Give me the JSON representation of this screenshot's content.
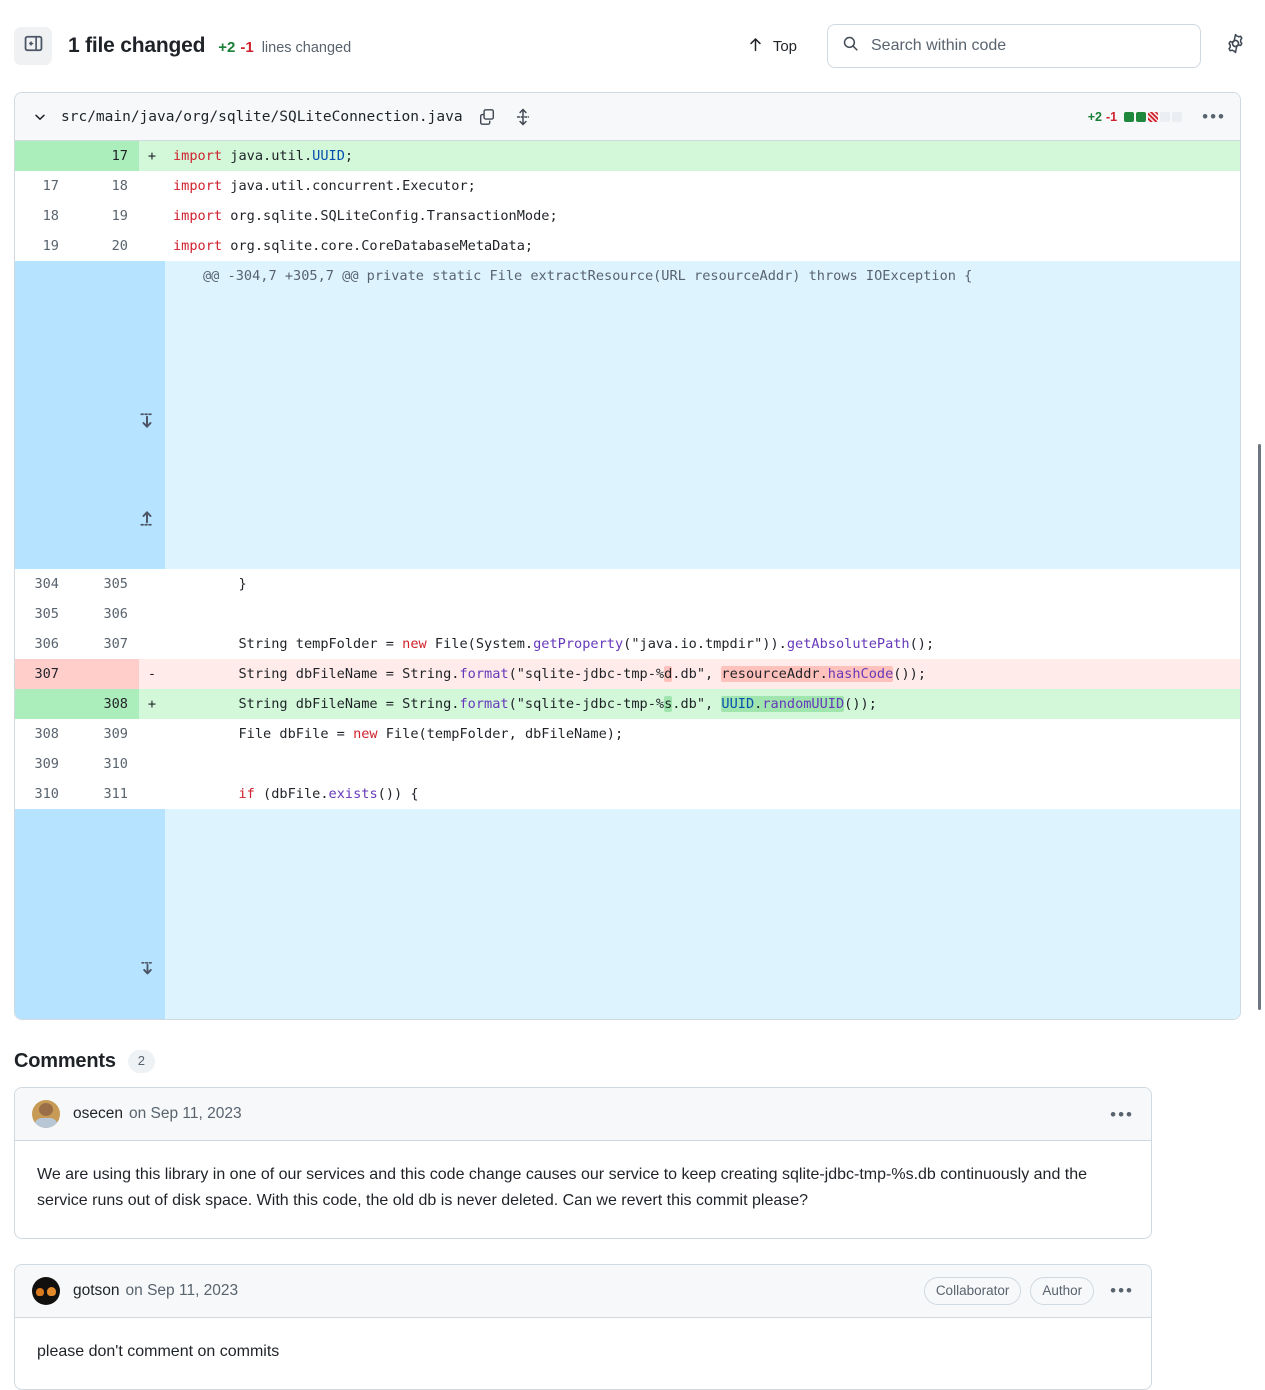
{
  "header": {
    "sidebar_toggle_icon": "sidebar-collapse-icon",
    "files_changed": "1 file changed",
    "additions": "+2",
    "deletions": "-1",
    "lines_changed_label": "lines changed",
    "top_label": "Top",
    "top_icon": "arrow-up-icon",
    "search": {
      "icon": "search-icon",
      "placeholder": "Search within code",
      "value": ""
    },
    "settings_icon": "gear-icon"
  },
  "file": {
    "chevron_icon": "chevron-down-icon",
    "path": "src/main/java/org/sqlite/SQLiteConnection.java",
    "copy_icon": "copy-icon",
    "expand_icon": "expand-all-icon",
    "additions": "+2",
    "deletions": "-1",
    "stat_blocks": [
      "add",
      "add",
      "del",
      "none",
      "none"
    ],
    "menu_icon": "kebab-menu-icon"
  },
  "diff": {
    "rows": [
      {
        "type": "add",
        "old": "",
        "new": "17",
        "mark": "+",
        "code": "import java.util.UUID;"
      },
      {
        "type": "ctx",
        "old": "17",
        "new": "18",
        "mark": "",
        "code": "import java.util.concurrent.Executor;"
      },
      {
        "type": "ctx",
        "old": "18",
        "new": "19",
        "mark": "",
        "code": "import org.sqlite.SQLiteConfig.TransactionMode;"
      },
      {
        "type": "ctx",
        "old": "19",
        "new": "20",
        "mark": "",
        "code": "import org.sqlite.core.CoreDatabaseMetaData;"
      },
      {
        "type": "hunk",
        "old": "",
        "new": "",
        "mark": "",
        "code": "@@ -304,7 +305,7 @@ private static File extractResource(URL resourceAddr) throws IOException {"
      },
      {
        "type": "ctx",
        "old": "304",
        "new": "305",
        "mark": "",
        "code": "        }"
      },
      {
        "type": "ctx",
        "old": "305",
        "new": "306",
        "mark": "",
        "code": ""
      },
      {
        "type": "ctx",
        "old": "306",
        "new": "307",
        "mark": "",
        "code": "        String tempFolder = new File(System.getProperty(\"java.io.tmpdir\")).getAbsolutePath();"
      },
      {
        "type": "del",
        "old": "307",
        "new": "",
        "mark": "-",
        "code": "        String dbFileName = String.format(\"sqlite-jdbc-tmp-%d.db\", resourceAddr.hashCode());"
      },
      {
        "type": "add",
        "old": "",
        "new": "308",
        "mark": "+",
        "code": "        String dbFileName = String.format(\"sqlite-jdbc-tmp-%s.db\", UUID.randomUUID());"
      },
      {
        "type": "ctx",
        "old": "308",
        "new": "309",
        "mark": "",
        "code": "        File dbFile = new File(tempFolder, dbFileName);"
      },
      {
        "type": "ctx",
        "old": "309",
        "new": "310",
        "mark": "",
        "code": ""
      },
      {
        "type": "ctx",
        "old": "310",
        "new": "311",
        "mark": "",
        "code": "        if (dbFile.exists()) {"
      },
      {
        "type": "hunk_end",
        "old": "",
        "new": "",
        "mark": "",
        "code": ""
      }
    ],
    "hunk_header_text": "@@ -304,7 +305,7 @@ private static File extractResource(URL resourceAddr) throws IOException {",
    "expand_up_icon": "expand-up-icon",
    "expand_down_icon": "expand-down-icon"
  },
  "comments_section": {
    "title": "Comments",
    "count": "2",
    "items": [
      {
        "author": "osecen",
        "date": "on Sep 11, 2023",
        "avatar": "avatar-osecen",
        "badges": [],
        "menu_icon": "kebab-menu-icon",
        "body": "We are using this library in one of our services and this code change causes our service to keep creating sqlite-jdbc-tmp-%s.db continuously and the service runs out of disk space. With this code, the old db is never deleted. Can we revert this commit please?"
      },
      {
        "author": "gotson",
        "date": "on Sep 11, 2023",
        "avatar": "avatar-gotson",
        "badges": [
          "Collaborator",
          "Author"
        ],
        "menu_icon": "kebab-menu-icon",
        "body": "please don't comment on commits"
      }
    ]
  },
  "colors": {
    "addition_green": "#1a7f37",
    "deletion_red": "#cf222e",
    "add_row_bg": "#d2f8d9",
    "add_gutter_bg": "#aceebb",
    "del_row_bg": "#ffebe9",
    "del_gutter_bg": "#ffcecb",
    "hunk_bg": "#ddf4ff",
    "hunk_gutter_bg": "#b6e3ff",
    "border": "#d1d9e0",
    "muted_text": "#59636e"
  }
}
